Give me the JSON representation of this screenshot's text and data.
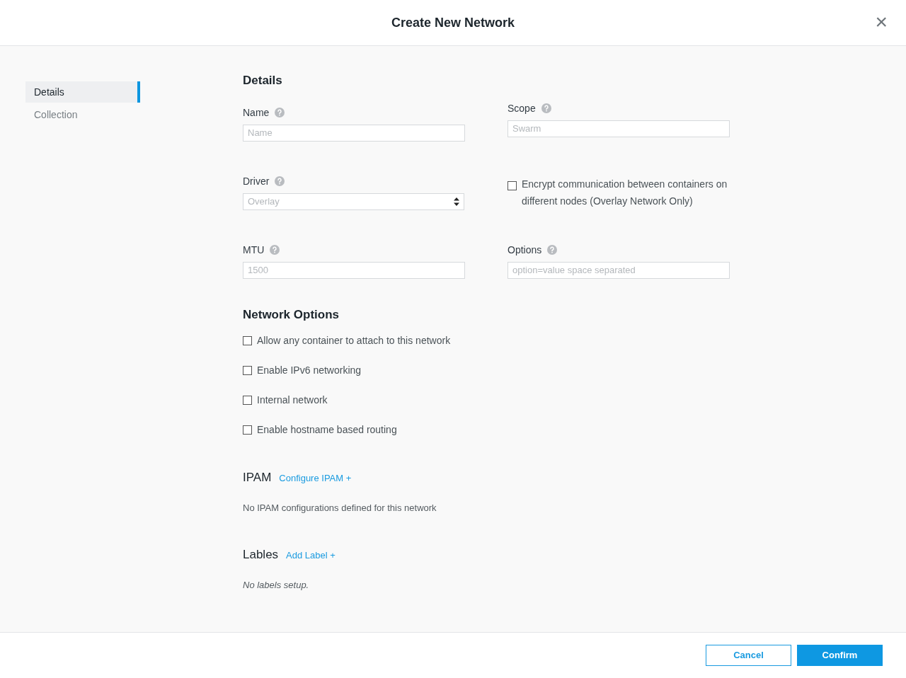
{
  "dialog": {
    "title": "Create New Network",
    "close": "×"
  },
  "sidebar": {
    "items": [
      {
        "label": "Details",
        "selected": true
      },
      {
        "label": "Collection",
        "selected": false
      }
    ]
  },
  "details": {
    "heading": "Details",
    "name": {
      "label": "Name",
      "placeholder": "Name"
    },
    "scope": {
      "label": "Scope",
      "placeholder": "Swarm"
    },
    "driver": {
      "label": "Driver",
      "placeholder": "Overlay"
    },
    "encrypt": {
      "label": "Encrypt communication between containers on different nodes (Overlay Network Only)",
      "checked": false
    },
    "mtu": {
      "label": "MTU",
      "placeholder": "1500"
    },
    "options": {
      "label": "Options",
      "placeholder": "option=value space separated"
    }
  },
  "network_options": {
    "heading": "Network Options",
    "items": [
      {
        "label": "Allow any container to attach to this network",
        "checked": false
      },
      {
        "label": "Enable IPv6 networking",
        "checked": false
      },
      {
        "label": "Internal network",
        "checked": false
      },
      {
        "label": "Enable hostname based routing",
        "checked": false
      }
    ]
  },
  "ipam": {
    "heading": "IPAM",
    "link": "Configure IPAM +",
    "empty": "No IPAM configurations defined for this network"
  },
  "labels": {
    "heading": "Lables",
    "link": "Add Label +",
    "empty": "No labels setup."
  },
  "buttons": {
    "cancel": "Cancel",
    "confirm": "Confirm"
  }
}
